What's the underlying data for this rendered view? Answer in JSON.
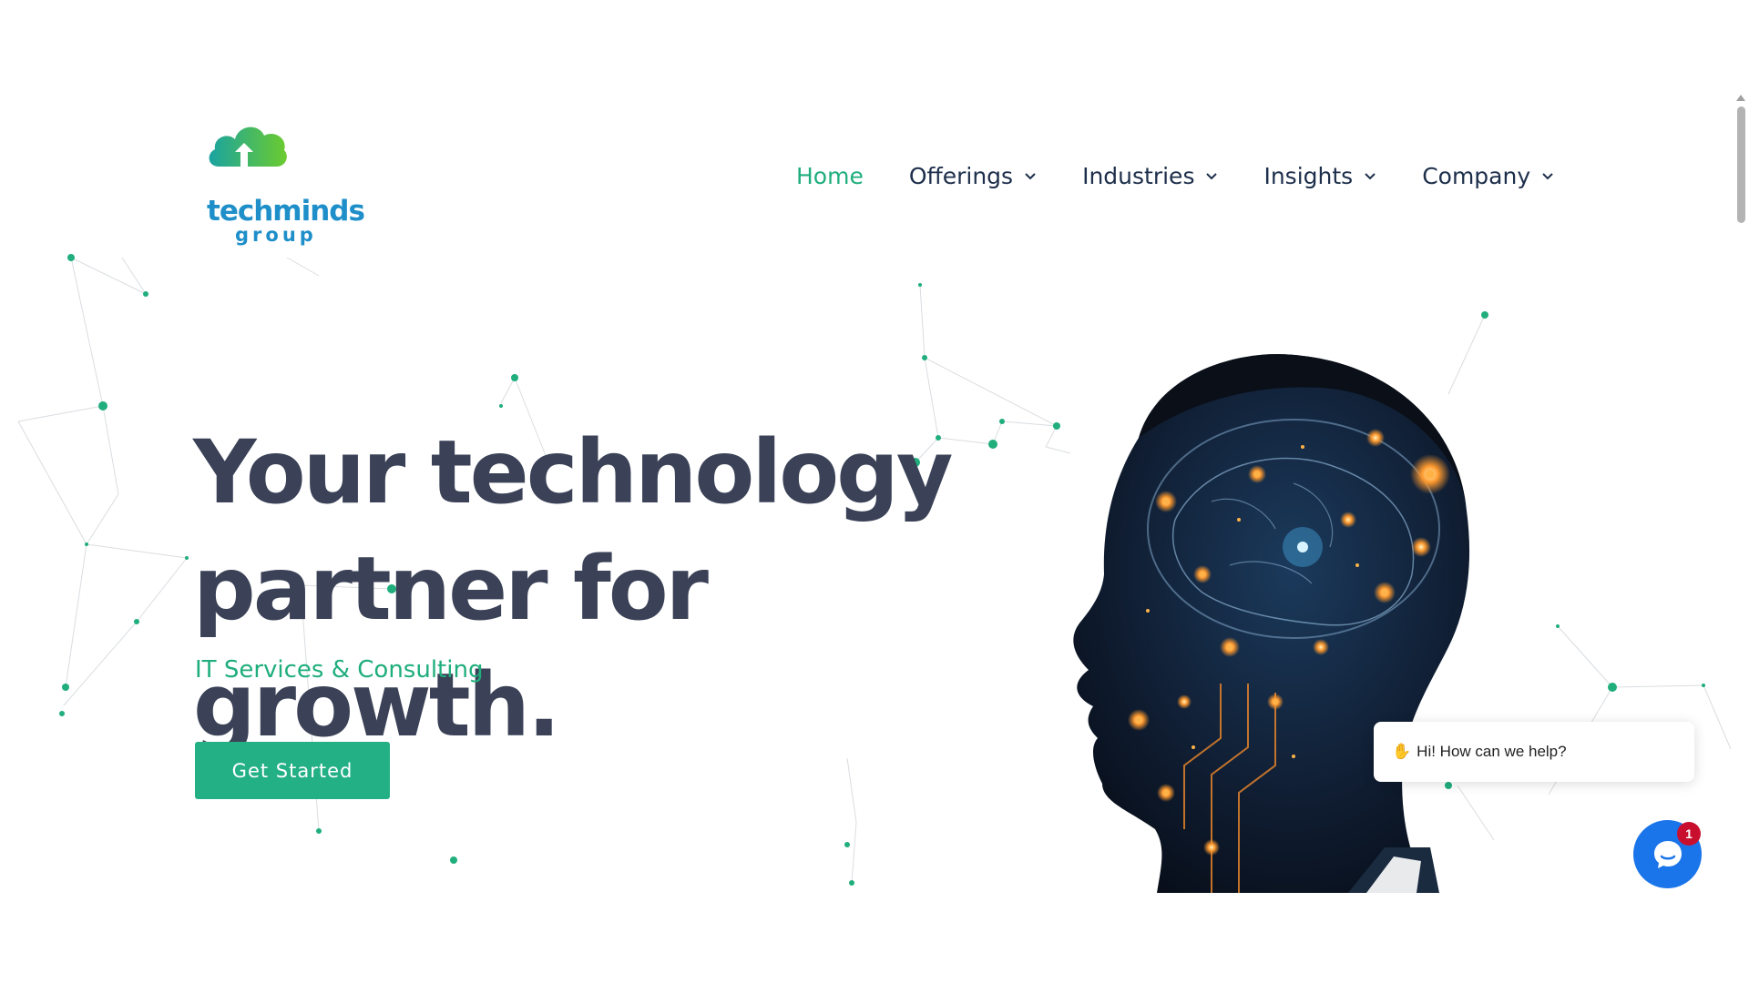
{
  "logo": {
    "word": "techminds",
    "sub": "group"
  },
  "nav": [
    {
      "label": "Home",
      "active": true,
      "has_dropdown": false
    },
    {
      "label": "Offerings",
      "active": false,
      "has_dropdown": true
    },
    {
      "label": "Industries",
      "active": false,
      "has_dropdown": true
    },
    {
      "label": "Insights",
      "active": false,
      "has_dropdown": true
    },
    {
      "label": "Company",
      "active": false,
      "has_dropdown": true
    }
  ],
  "hero": {
    "title_line1": "Your technology",
    "title_line2": "partner for growth.",
    "subtitle": "IT Services & Consulting",
    "cta_label": "Get Started"
  },
  "chat": {
    "greeting": "Hi! How can we help?",
    "greeting_icon": "waving-hand-icon",
    "unread_count": "1"
  },
  "colors": {
    "accent_green": "#1fae7c",
    "button_green": "#24b085",
    "nav_text": "#1d2f4b",
    "title_text": "#3b4257",
    "logo_blue": "#1f8fc9",
    "chat_blue": "#1a74ea",
    "badge_red": "#c8102e"
  }
}
